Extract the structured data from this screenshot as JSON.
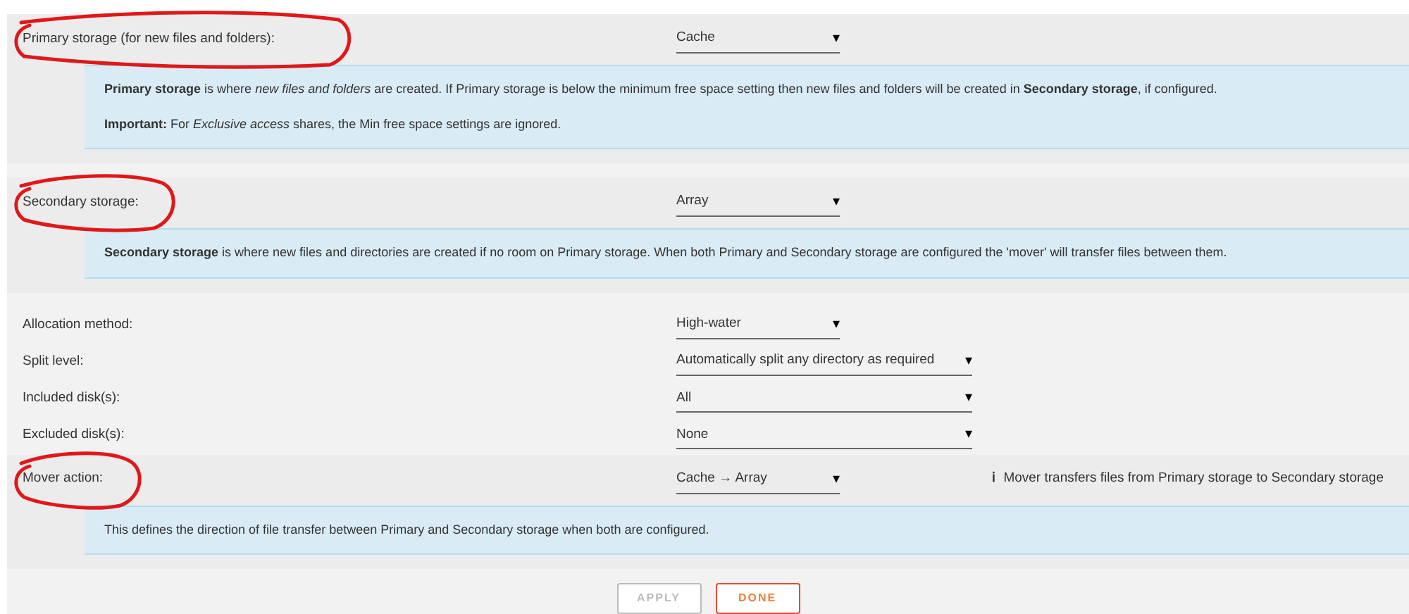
{
  "settings": [
    {
      "kind": "section",
      "label": "Primary storage (for new files and folders):",
      "value": "Cache",
      "wide": false,
      "circled": true,
      "help": [
        "**Primary storage** is where *new files and folders* are created. If Primary storage is below the minimum free space setting then new files and folders will be created in **Secondary storage**, if configured.",
        "**Important:** For *Exclusive access* shares, the Min free space settings are ignored."
      ]
    },
    {
      "kind": "section",
      "label": "Secondary storage:",
      "value": "Array",
      "wide": false,
      "circled": true,
      "help": [
        "**Secondary storage** is where new files and directories are created if no room on Primary storage. When both Primary and Secondary storage are configured the 'mover' will transfer files between them."
      ]
    },
    {
      "kind": "plain",
      "label": "Allocation method:",
      "value": "High-water",
      "wide": false,
      "circled": false
    },
    {
      "kind": "plain",
      "label": "Split level:",
      "value": "Automatically split any directory as required",
      "wide": true,
      "circled": false
    },
    {
      "kind": "plain",
      "label": "Included disk(s):",
      "value": "All",
      "wide": true,
      "circled": false
    },
    {
      "kind": "plain",
      "label": "Excluded disk(s):",
      "value": "None",
      "wide": true,
      "circled": false
    },
    {
      "kind": "section",
      "label": "Mover action:",
      "value": "Cache → Array",
      "wide": false,
      "circled": true,
      "note": "Mover transfers files from Primary storage to Secondary storage",
      "help": [
        "This defines the direction of file transfer between Primary and Secondary storage when both are configured."
      ]
    }
  ],
  "caret": "▾",
  "info_glyph": "ℹ",
  "buttons": [
    {
      "label": "APPLY",
      "disabled": true
    },
    {
      "label": "DONE",
      "disabled": false
    }
  ]
}
